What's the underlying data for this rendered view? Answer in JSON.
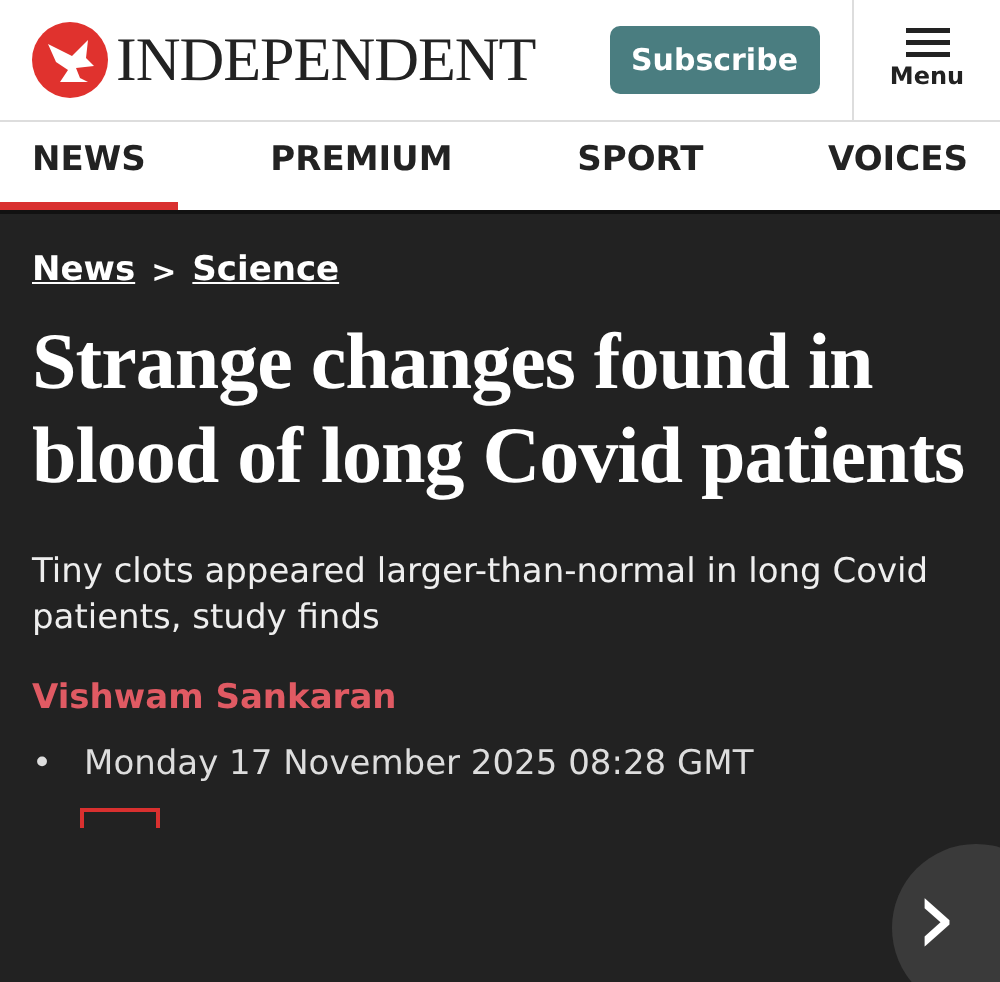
{
  "header": {
    "logo": "INDEPENDENT",
    "subscribe": "Subscribe",
    "menu": "Menu"
  },
  "tabs": [
    {
      "label": "NEWS",
      "selected": true
    },
    {
      "label": "PREMIUM",
      "selected": false
    },
    {
      "label": "SPORT",
      "selected": false
    },
    {
      "label": "VOICES",
      "selected": false
    }
  ],
  "breadcrumb": {
    "items": [
      "News",
      "Science"
    ],
    "separator": ">"
  },
  "headline": "Strange changes found in blood of long Covid patients",
  "standfirst": "Tiny clots appeared larger-than-normal in long Covid patients, study finds",
  "author": "Vishwam Sankaran",
  "date": {
    "bullet": "•",
    "text": "Monday 17 November 2025 08:28 GMT"
  },
  "next_button": {
    "glyph": "›"
  }
}
